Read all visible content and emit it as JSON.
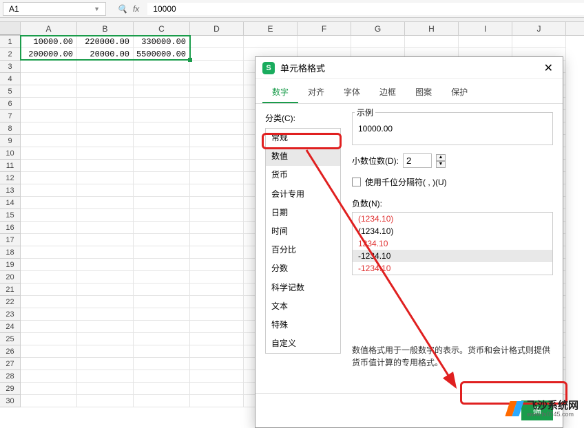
{
  "formula_bar": {
    "cell_ref": "A1",
    "fx_label": "fx",
    "value": "10000"
  },
  "columns": [
    "A",
    "B",
    "C",
    "D",
    "E",
    "F",
    "G",
    "H",
    "I",
    "J"
  ],
  "row_count": 30,
  "data_rows": [
    [
      "10000.00",
      "220000.00",
      "330000.00"
    ],
    [
      "200000.00",
      "20000.00",
      "5500000.00"
    ]
  ],
  "dialog": {
    "title": "单元格格式",
    "close": "✕",
    "tabs": [
      "数字",
      "对齐",
      "字体",
      "边框",
      "图案",
      "保护"
    ],
    "active_tab": 0,
    "category_label": "分类(C):",
    "categories": [
      "常规",
      "数值",
      "货币",
      "会计专用",
      "日期",
      "时间",
      "百分比",
      "分数",
      "科学记数",
      "文本",
      "特殊",
      "自定义"
    ],
    "selected_category": 1,
    "example_label": "示例",
    "example_value": "10000.00",
    "decimal_label": "小数位数(D):",
    "decimal_value": "2",
    "thousands_label": "使用千位分隔符( , )(U)",
    "thousands_checked": false,
    "negative_label": "负数(N):",
    "negative_formats": [
      {
        "text": "(1234.10)",
        "red": true
      },
      {
        "text": "(1234.10)",
        "red": false
      },
      {
        "text": "1234.10",
        "red": true
      },
      {
        "text": "-1234.10",
        "red": false,
        "selected": true
      },
      {
        "text": "-1234.10",
        "red": true
      }
    ],
    "description": "数值格式用于一般数字的表示。货币和会计格式则提供货币值计算的专用格式。",
    "ok_button": "确"
  },
  "watermark": {
    "name": "飞沙系统网",
    "url": "www.fs0745.com"
  }
}
